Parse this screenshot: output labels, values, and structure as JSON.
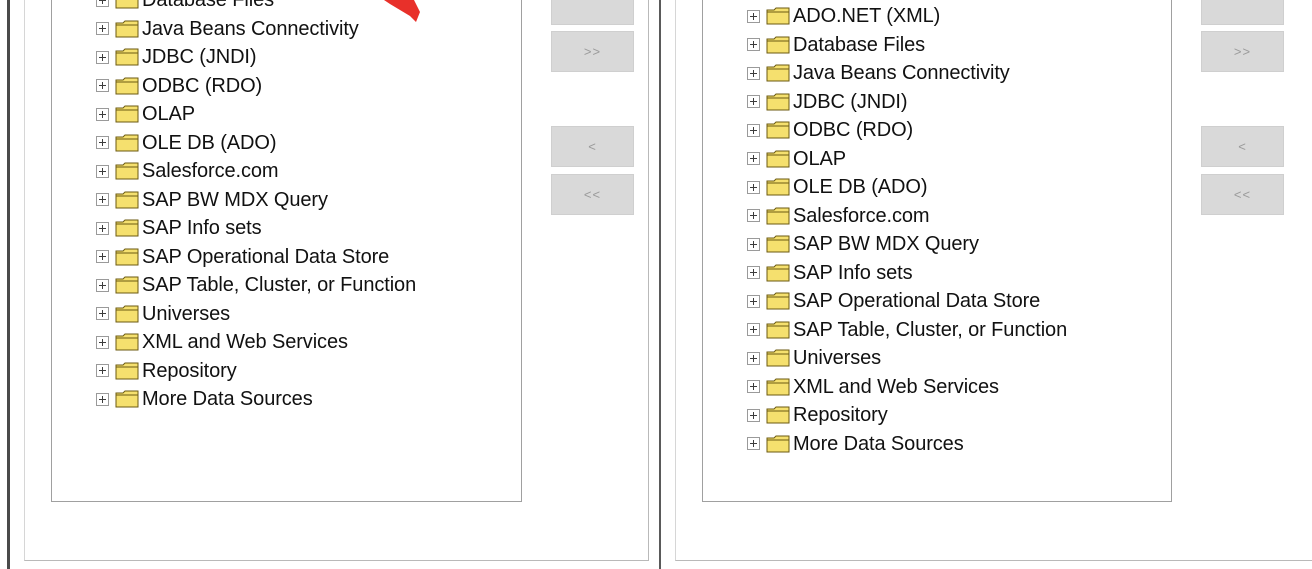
{
  "left_panel": {
    "tree_items": [
      "Database Files",
      "Java Beans Connectivity",
      "JDBC (JNDI)",
      "ODBC (RDO)",
      "OLAP",
      "OLE DB (ADO)",
      "Salesforce.com",
      "SAP BW MDX Query",
      "SAP Info sets",
      "SAP Operational Data Store",
      "SAP Table, Cluster, or Function",
      "Universes",
      "XML and Web Services",
      "Repository",
      "More Data Sources"
    ],
    "buttons": {
      "add_all": ">>",
      "remove": "<",
      "remove_all": "<<"
    }
  },
  "right_panel": {
    "tree_items": [
      "ADO.NET (XML)",
      "Database Files",
      "Java Beans Connectivity",
      "JDBC (JNDI)",
      "ODBC (RDO)",
      "OLAP",
      "OLE DB (ADO)",
      "Salesforce.com",
      "SAP BW MDX Query",
      "SAP Info sets",
      "SAP Operational Data Store",
      "SAP Table, Cluster, or Function",
      "Universes",
      "XML and Web Services",
      "Repository",
      "More Data Sources"
    ],
    "buttons": {
      "add_all": ">>",
      "remove": "<",
      "remove_all": "<<"
    }
  },
  "icons": {
    "expander": "plus-box-icon",
    "node": "folder-icon",
    "annotation": "red-arrow-icon"
  },
  "colors": {
    "folder_fill": "#f5e06e",
    "folder_outline": "#6b5a12",
    "button_face": "#d9d9d9",
    "button_text": "#9a9a9a",
    "annotation_red": "#e8302a"
  }
}
